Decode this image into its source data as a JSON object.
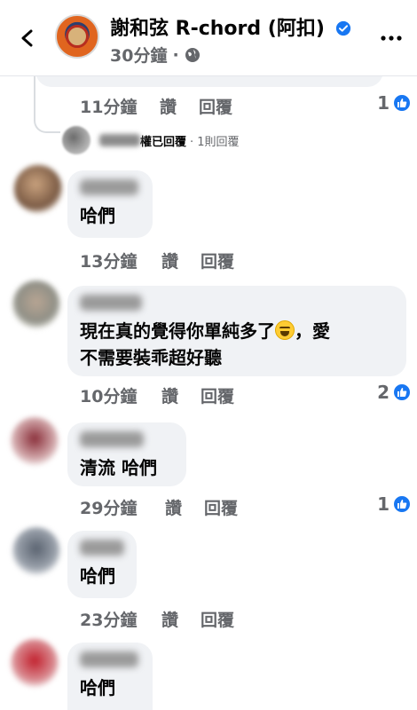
{
  "header": {
    "page_name": "謝和弦 R-chord (阿扣)",
    "post_time": "30分鐘",
    "separator": "·"
  },
  "comments_top": {
    "time": "11分鐘",
    "like_label": "讚",
    "reply_label": "回覆",
    "reaction_count": "1"
  },
  "replied_row": {
    "replied_text": "權已回覆",
    "count_text": "· 1則回覆"
  },
  "comments": [
    {
      "text": "哈們",
      "time": "13分鐘",
      "like_label": "讚",
      "reply_label": "回覆",
      "reaction_count": ""
    },
    {
      "text_line1": "現在真的覺得你單純多了",
      "text_after_emoji": "，愛",
      "text_line2": "不需要裝乖超好聽",
      "emoji": "grinning-squinting-face",
      "time": "10分鐘",
      "like_label": "讚",
      "reply_label": "回覆",
      "reaction_count": "2"
    },
    {
      "text": "清流 哈們",
      "time": "29分鐘",
      "like_label": "讚",
      "reply_label": "回覆",
      "reaction_count": "1"
    },
    {
      "text": "哈們",
      "time": "23分鐘",
      "like_label": "讚",
      "reply_label": "回覆",
      "reaction_count": ""
    },
    {
      "text": "哈們"
    }
  ],
  "colors": {
    "brand_blue": "#1877f2",
    "bubble_bg": "#f0f2f5",
    "meta_gray": "#65676b"
  },
  "icons": [
    "back-arrow-icon",
    "verified-badge-icon",
    "globe-icon",
    "more-options-icon",
    "like-reaction-icon"
  ]
}
